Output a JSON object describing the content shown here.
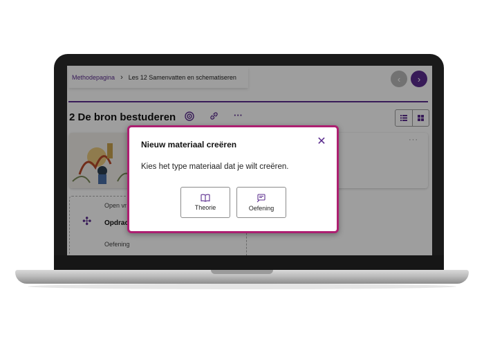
{
  "breadcrumb": {
    "root": "Methodepagina",
    "separator": "›",
    "current": "Les 12 Samenvatten en schematiseren"
  },
  "nav": {
    "prev_icon": "chevron-left-icon",
    "next_icon": "chevron-right-icon"
  },
  "page": {
    "title": "2 De bron bestuderen",
    "icons": [
      "target-icon",
      "link-icon",
      "more-icon"
    ]
  },
  "cards": {
    "card2_menu": "···",
    "card3": {
      "label_top": "Open vr",
      "title": "Opdrac",
      "label_bottom": "Oefening"
    }
  },
  "dialog": {
    "title": "Nieuw materiaal creëren",
    "text": "Kies het type materiaal dat je wilt creëren.",
    "options": [
      {
        "label": "Theorie",
        "icon": "book-icon"
      },
      {
        "label": "Oefening",
        "icon": "exercise-icon"
      }
    ]
  },
  "colors": {
    "accent": "#5b2d8e",
    "dialog_border": "#ad1f71",
    "laptop_frame": "#1a1a1a"
  }
}
